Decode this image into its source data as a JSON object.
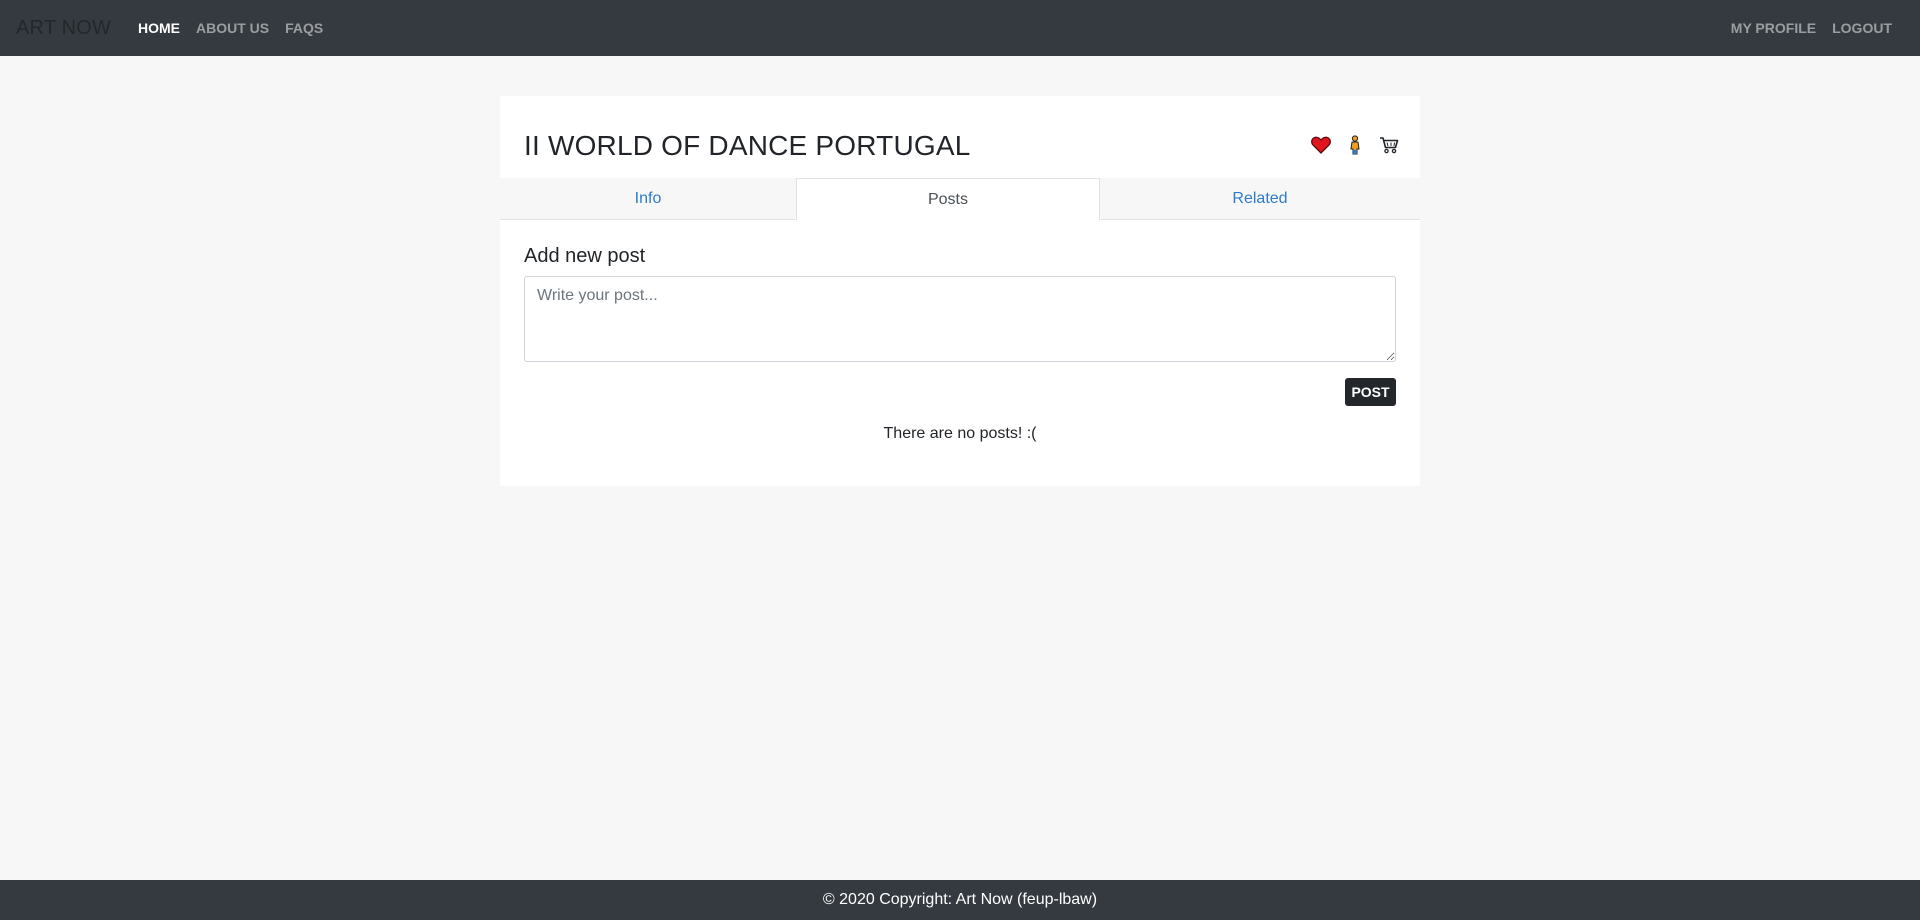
{
  "navbar": {
    "brand": "ART NOW",
    "left_links": [
      {
        "label": "HOME",
        "active": true
      },
      {
        "label": "ABOUT US",
        "active": false
      },
      {
        "label": "FAQS",
        "active": false
      }
    ],
    "right_links": [
      {
        "label": "MY PROFILE"
      },
      {
        "label": "LOGOUT"
      }
    ]
  },
  "event": {
    "title": "II WORLD OF DANCE PORTUGAL",
    "actions": [
      {
        "icon": "heart-icon",
        "color": "#e0161f"
      },
      {
        "icon": "person-icon",
        "color": "#f0a020"
      },
      {
        "icon": "cart-icon",
        "color": "#212529"
      }
    ]
  },
  "tabs": [
    {
      "label": "Info",
      "active": false
    },
    {
      "label": "Posts",
      "active": true
    },
    {
      "label": "Related",
      "active": false
    }
  ],
  "posts": {
    "section_title": "Add new post",
    "placeholder": "Write your post...",
    "value": "",
    "button_label": "POST",
    "empty_message": "There are no posts! :("
  },
  "footer": {
    "text": "© 2020 Copyright: Art Now (feup-lbaw)"
  },
  "colors": {
    "navbar_bg": "#343a40",
    "page_bg": "#f7f7f7",
    "link_blue": "#2f7bc9",
    "button_dark": "#23272b"
  }
}
